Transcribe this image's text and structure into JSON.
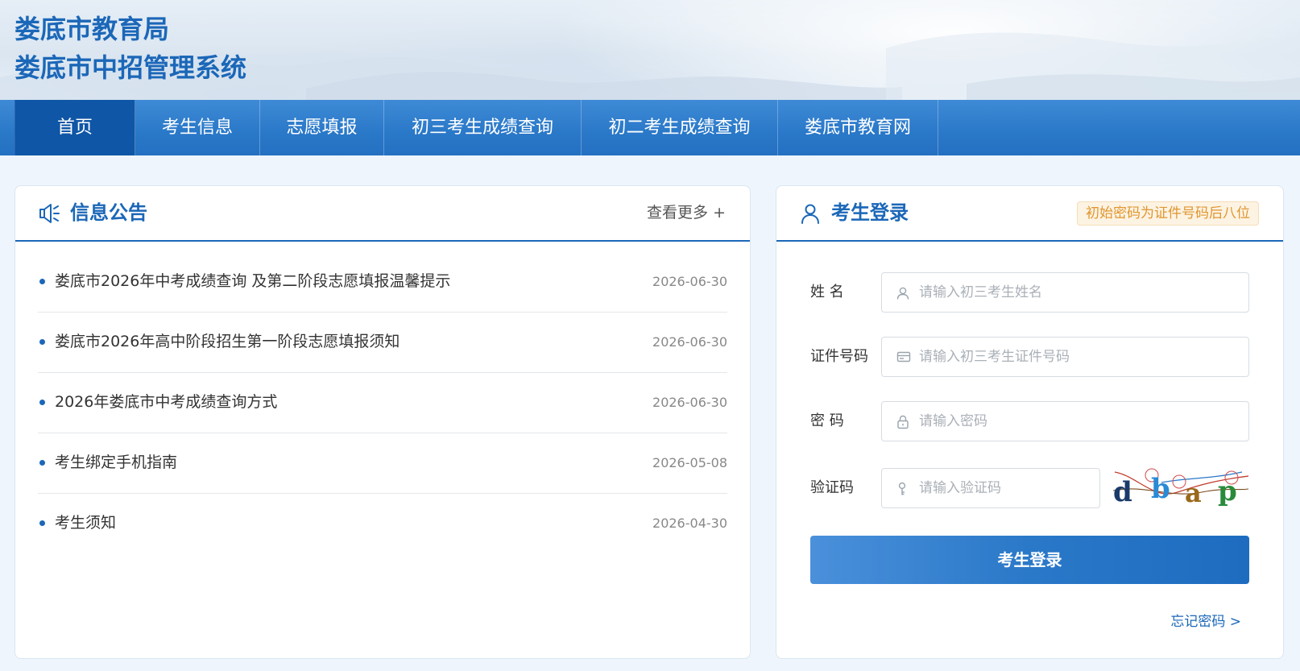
{
  "header": {
    "title_line1": "娄底市教育局",
    "title_line2": "娄底市中招管理系统"
  },
  "nav": {
    "items": [
      {
        "label": "首页",
        "active": true
      },
      {
        "label": "考生信息"
      },
      {
        "label": "志愿填报"
      },
      {
        "label": "初三考生成绩查询"
      },
      {
        "label": "初二考生成绩查询"
      },
      {
        "label": "娄底市教育网"
      }
    ]
  },
  "news": {
    "icon": "megaphone-icon",
    "title": "信息公告",
    "more_label": "查看更多 +",
    "items": [
      {
        "text": "娄底市2026年中考成绩查询 及第二阶段志愿填报温馨提示",
        "date": "2026-06-30"
      },
      {
        "text": "娄底市2026年高中阶段招生第一阶段志愿填报须知",
        "date": "2026-06-30"
      },
      {
        "text": "2026年娄底市中考成绩查询方式",
        "date": "2026-06-30"
      },
      {
        "text": "考生绑定手机指南",
        "date": "2026-05-08"
      },
      {
        "text": "考生须知",
        "date": "2026-04-30"
      }
    ]
  },
  "login": {
    "icon": "user-icon",
    "title": "考生登录",
    "hint": "初始密码为证件号码后八位",
    "fields": {
      "name": {
        "label": "姓 名",
        "placeholder": "请输入初三考生姓名",
        "icon": "user-icon"
      },
      "id": {
        "label": "证件号码",
        "placeholder": "请输入初三考生证件号码",
        "icon": "id-card-icon"
      },
      "password": {
        "label": "密 码",
        "placeholder": "请输入密码",
        "icon": "lock-icon"
      },
      "captcha": {
        "label": "验证码",
        "placeholder": "请输入验证码",
        "icon": "key-icon",
        "captcha_text": "dbap"
      }
    },
    "submit_label": "考生登录",
    "forgot_label": "忘记密码 >"
  },
  "colors": {
    "brand": "#1b67b8",
    "nav_bg": "#2a78c8",
    "nav_active": "#0f56a6",
    "hint_text": "#e0962f",
    "page_bg": "#eef5fc"
  }
}
